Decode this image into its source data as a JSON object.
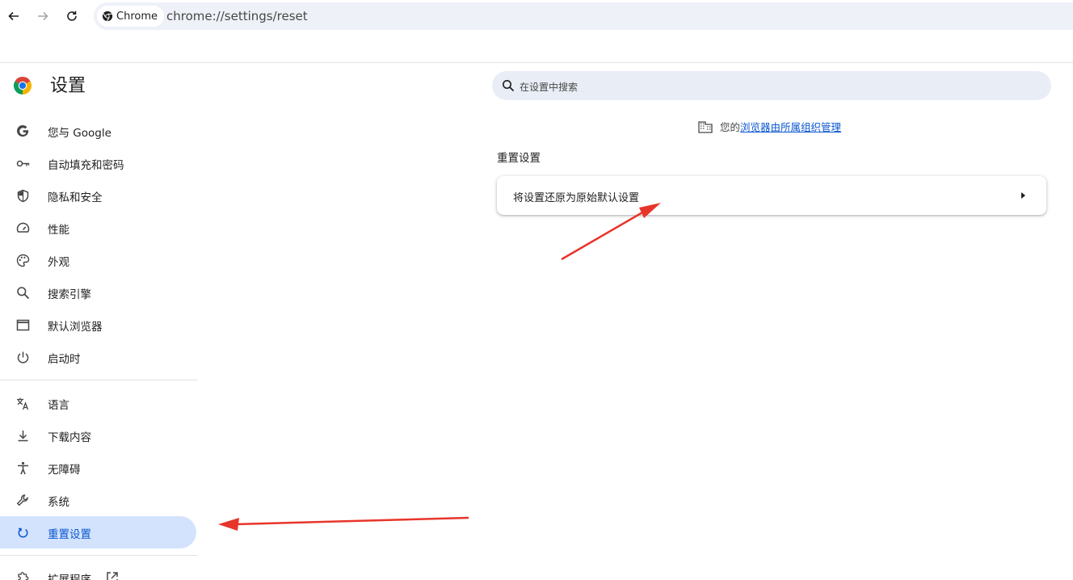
{
  "browser": {
    "chip_label": "Chrome",
    "url": "chrome://settings/reset"
  },
  "sidebar": {
    "title": "设置",
    "items": [
      {
        "label": "您与 Google",
        "icon": "google-icon"
      },
      {
        "label": "自动填充和密码",
        "icon": "key-icon"
      },
      {
        "label": "隐私和安全",
        "icon": "shield-icon"
      },
      {
        "label": "性能",
        "icon": "speedometer-icon"
      },
      {
        "label": "外观",
        "icon": "palette-icon"
      },
      {
        "label": "搜索引擎",
        "icon": "search-icon"
      },
      {
        "label": "默认浏览器",
        "icon": "browser-window-icon"
      },
      {
        "label": "启动时",
        "icon": "power-icon"
      },
      {
        "label": "语言",
        "icon": "translate-icon"
      },
      {
        "label": "下载内容",
        "icon": "download-icon"
      },
      {
        "label": "无障碍",
        "icon": "accessibility-icon"
      },
      {
        "label": "系统",
        "icon": "wrench-icon"
      },
      {
        "label": "重置设置",
        "icon": "reset-icon",
        "active": true
      },
      {
        "label": "扩展程序",
        "icon": "puzzle-icon"
      }
    ]
  },
  "main": {
    "search_placeholder": "在设置中搜索",
    "managed_prefix": "您的",
    "managed_link": "浏览器由所属组织管理",
    "section_title": "重置设置",
    "reset_row_label": "将设置还原为原始默认设置"
  },
  "colors": {
    "accent": "#0b57d0",
    "active_bg": "#d3e3fd",
    "annotation_arrow": "#e8352a"
  }
}
